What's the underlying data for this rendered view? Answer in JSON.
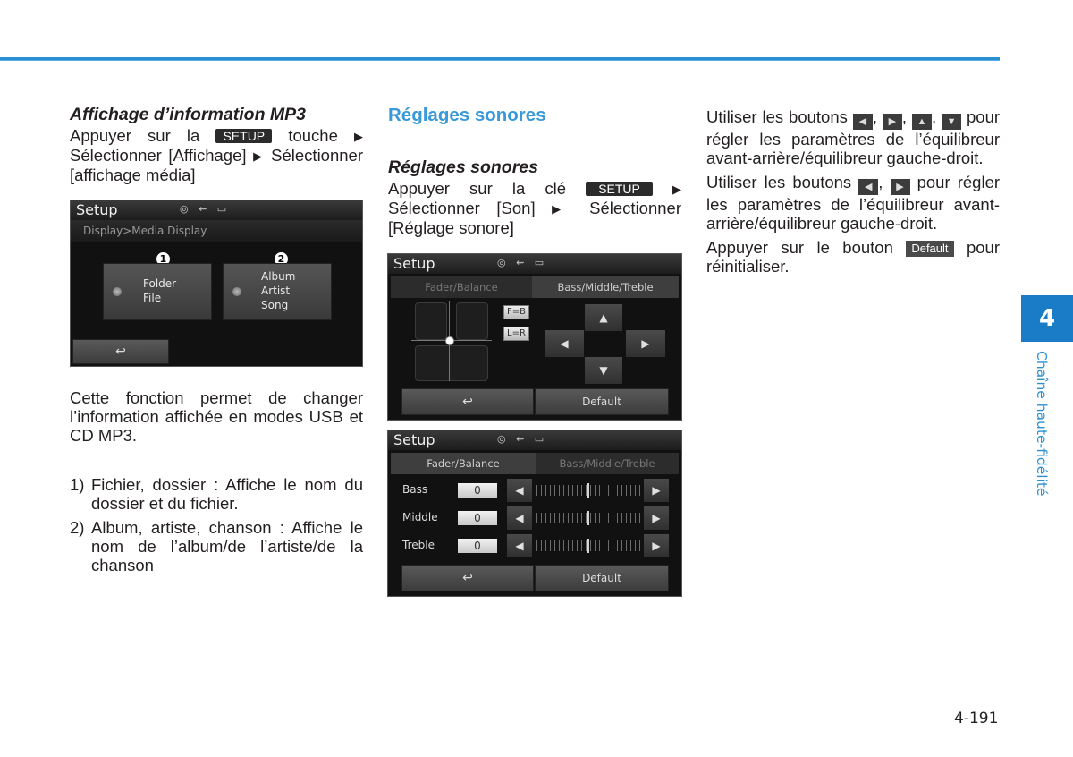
{
  "header": {
    "rule_color": "#2a8fd0"
  },
  "col1": {
    "heading": "Affichage d’information MP3",
    "instr_parts": [
      "Appuyer sur la",
      "SETUP",
      "touche",
      "▶",
      "Sélectionner [Affichage]",
      "▶",
      "Sélectionner [affichage média]"
    ],
    "screen": {
      "title": "Setup",
      "status_icons": "◎ ⇜ ▭",
      "breadcrumb": "Display>Media Display",
      "option1": {
        "marker": "1",
        "label_lines": [
          "Folder",
          "File"
        ]
      },
      "option2": {
        "marker": "2",
        "label_lines": [
          "Album",
          "Artist",
          "Song"
        ]
      },
      "back_icon": "↩"
    },
    "description": "Cette fonction permet de changer l’information affichée en modes USB et CD MP3.",
    "items": [
      {
        "n": "1)",
        "text": "Fichier, dossier : Affiche le nom du dossier et du fichier."
      },
      {
        "n": "2)",
        "text": "Album, artiste, chanson : Affiche le nom de l’album/de l’artiste/de la chanson"
      }
    ]
  },
  "col2": {
    "section_title": "Réglages sonores",
    "subheading": "Réglages sonores",
    "instr_parts": [
      "Appuyer sur la clé",
      "SETUP",
      "▶",
      "Sélectionner [Son]",
      "▶",
      "Sélectionner [Réglage sonore]"
    ],
    "screen_fader": {
      "title": "Setup",
      "status_icons": "◎ ⇜ ▭",
      "tab_active": "Fader/Balance",
      "tab_inactive": "Bass/Middle/Treble",
      "fb_label": "F=B",
      "lr_label": "L=R",
      "up": "▲",
      "down": "▼",
      "left": "◀",
      "right": "▶",
      "back_icon": "↩",
      "default_label": "Default"
    },
    "screen_tone": {
      "title": "Setup",
      "status_icons": "◎ ⇜ ▭",
      "tab_inactive": "Fader/Balance",
      "tab_active": "Bass/Middle/Treble",
      "rows": [
        {
          "label": "Bass",
          "value": "0",
          "level": 0.5
        },
        {
          "label": "Middle",
          "value": "0",
          "level": 0.5
        },
        {
          "label": "Treble",
          "value": "0",
          "level": 0.5
        }
      ],
      "left": "◀",
      "right": "▶",
      "back_icon": "↩",
      "default_label": "Default"
    }
  },
  "col3": {
    "p1_start": "Utiliser les boutons",
    "p1_icons": [
      "◀",
      "▶",
      "▲",
      "▼"
    ],
    "p1_end": "pour régler les paramètres de l’équilibreur avant-arrière/équilibreur gauche-droit.",
    "p2_start": "Utiliser les boutons",
    "p2_icons": [
      "◀",
      "▶"
    ],
    "p2_end": "pour régler les paramètres de l’équilibreur avant-arrière/équilibreur gauche-droit.",
    "p3_start": "Appuyer sur le bouton",
    "p3_key": "Default",
    "p3_end": "pour réinitialiser."
  },
  "sidebar": {
    "chapter_number": "4",
    "chapter_title": "Chaîne haute-fidélité",
    "tab_color": "#1a7cc7"
  },
  "footer": {
    "page_number": "4-191"
  }
}
